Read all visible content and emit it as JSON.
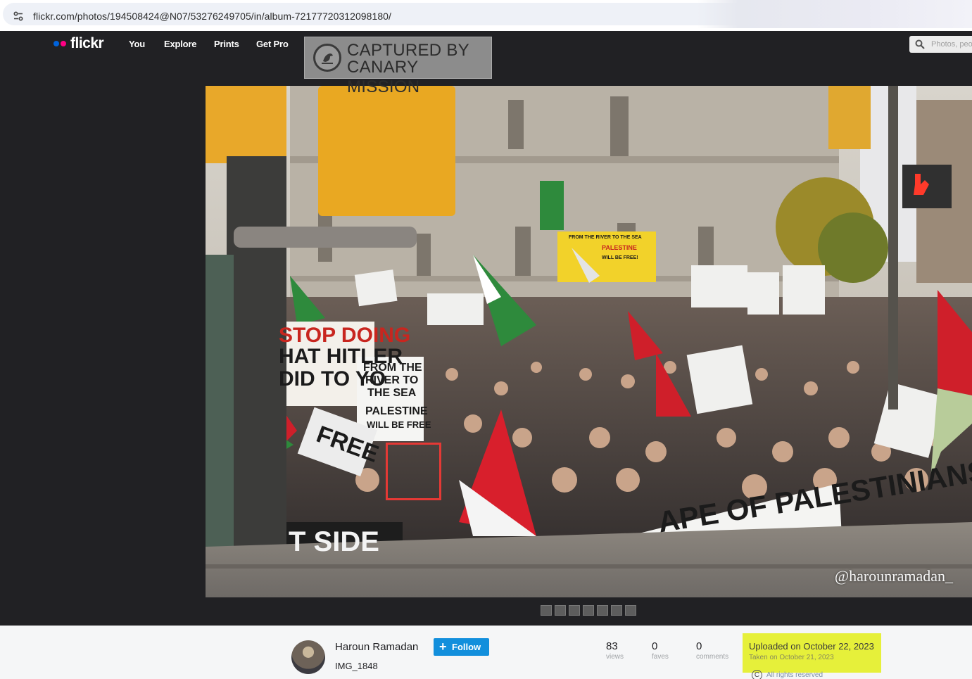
{
  "browser": {
    "url": "flickr.com/photos/194508424@N07/53276249705/in/album-72177720312098180/"
  },
  "nav": {
    "logo": "flickr",
    "links": [
      "You",
      "Explore",
      "Prints",
      "Get Pro"
    ],
    "search_placeholder": "Photos, peo"
  },
  "watermark": {
    "line1": "CAPTURED BY",
    "line2": "CANARY MISSION"
  },
  "photo": {
    "credit": "@harounramadan_",
    "signs": {
      "stop": [
        "STOP DOING",
        "HAT HITLER",
        "DID TO YO"
      ],
      "river": [
        "FROM THE",
        "RIVER TO",
        "THE SEA",
        "PALESTINE",
        "WILL BE FREE"
      ],
      "yellow_banner": [
        "FROM THE RIVER TO THE SEA",
        "PALESTINE",
        "WILL BE FREE!"
      ],
      "bottom_banner": "APE OF PALESTINIANS",
      "bottom_left": "T SIDE",
      "free": "FREE"
    }
  },
  "thumbnails": 7,
  "info": {
    "owner": "Haroun Ramadan",
    "follow": "Follow",
    "title": "IMG_1848",
    "stats": [
      {
        "value": "83",
        "label": "views"
      },
      {
        "value": "0",
        "label": "faves"
      },
      {
        "value": "0",
        "label": "comments"
      }
    ],
    "uploaded": "Uploaded on October 22, 2023",
    "taken": "Taken on October 21, 2023",
    "rights": "All rights reserved"
  },
  "colors": {
    "flickr_blue": "#0063dc",
    "flickr_pink": "#ff0084",
    "follow_button": "#128fdc",
    "highlight": "#e6f03a",
    "annotation_box": "#e53935"
  }
}
